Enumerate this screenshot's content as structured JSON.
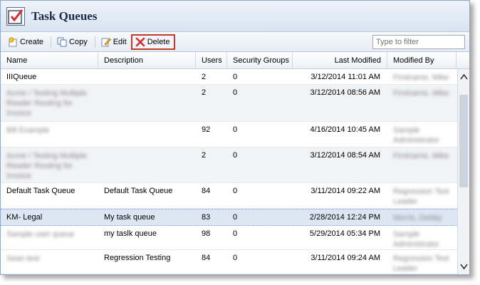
{
  "window": {
    "title": "Task Queues"
  },
  "toolbar": {
    "create_label": "Create",
    "copy_label": "Copy",
    "edit_label": "Edit",
    "delete_label": "Delete",
    "filter_placeholder": "Type to filter"
  },
  "columns": {
    "name": "Name",
    "description": "Description",
    "users": "Users",
    "security_groups": "Security Groups",
    "last_modified": "Last Modified",
    "modified_by": "Modified By"
  },
  "rows": [
    {
      "name": "IIIQueue",
      "description": "",
      "users": "2",
      "security_groups": "0",
      "last_modified": "3/12/2014 11:01 AM",
      "modified_by": "Firstname, Mike"
    },
    {
      "name": "Acme / Testing Multiple Reader Routing for Invoice",
      "description": "",
      "users": "2",
      "security_groups": "0",
      "last_modified": "3/12/2014 08:56 AM",
      "modified_by": "Firstname, Mike"
    },
    {
      "name": "Bill Example",
      "description": "",
      "users": "92",
      "security_groups": "0",
      "last_modified": "4/16/2014 10:45 AM",
      "modified_by": "Sample Administrator"
    },
    {
      "name": "Acme / Testing Multiple Reader Routing for Invoice",
      "description": "",
      "users": "2",
      "security_groups": "0",
      "last_modified": "3/12/2014 08:54 AM",
      "modified_by": "Firstname, Mike"
    },
    {
      "name": "Default Task Queue",
      "description": "Default Task Queue",
      "users": "84",
      "security_groups": "0",
      "last_modified": "3/11/2014 09:22 AM",
      "modified_by": "Regression Test Leader"
    },
    {
      "name": "KM- Legal",
      "description": "My task queue",
      "users": "83",
      "security_groups": "0",
      "last_modified": "2/28/2014 12:24 PM",
      "modified_by": "Morris, Debby"
    },
    {
      "name": "Sample user queue",
      "description": "my taslk queue",
      "users": "98",
      "security_groups": "0",
      "last_modified": "5/29/2014 05:34 PM",
      "modified_by": "Sample Administrator"
    },
    {
      "name": "Sean test",
      "description": "Regression Testing",
      "users": "84",
      "security_groups": "0",
      "last_modified": "3/11/2014 09:24 AM",
      "modified_by": "Regression Test Leader"
    }
  ]
}
